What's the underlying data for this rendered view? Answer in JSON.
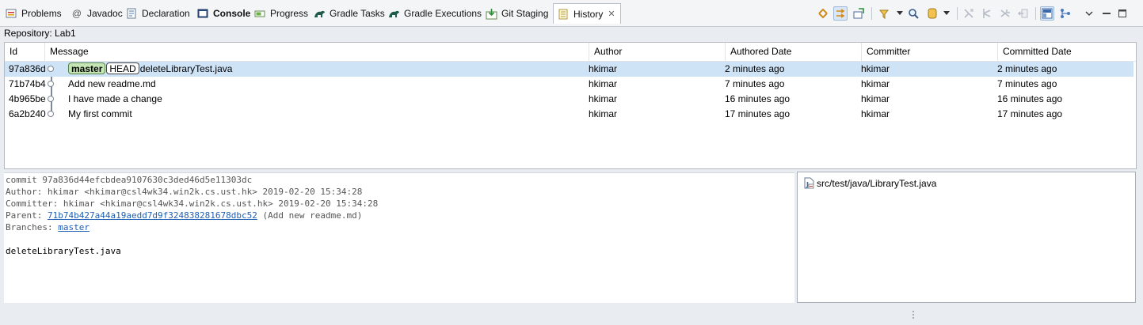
{
  "tabs": [
    {
      "label": "Problems",
      "icon": "problems-icon"
    },
    {
      "label": "Javadoc",
      "icon": "javadoc-icon"
    },
    {
      "label": "Declaration",
      "icon": "declaration-icon"
    },
    {
      "label": "Console",
      "icon": "console-icon"
    },
    {
      "label": "Progress",
      "icon": "progress-icon"
    },
    {
      "label": "Gradle Tasks",
      "icon": "gradle-icon"
    },
    {
      "label": "Gradle Executions",
      "icon": "gradle-icon"
    },
    {
      "label": "Git Staging",
      "icon": "git-staging-icon"
    },
    {
      "label": "History",
      "icon": "history-icon",
      "close": "✕"
    }
  ],
  "repository_label": "Repository: Lab1",
  "columns": [
    "Id",
    "Message",
    "Author",
    "Authored Date",
    "Committer",
    "Committed Date"
  ],
  "commits": [
    {
      "id": "97a836d",
      "refs": [
        "master",
        "HEAD"
      ],
      "message": "deleteLibraryTest.java",
      "author": "hkimar",
      "authored": "2 minutes ago",
      "committer": "hkimar",
      "committed": "2 minutes ago"
    },
    {
      "id": "71b74b4",
      "refs": [],
      "message": "Add new readme.md",
      "author": "hkimar",
      "authored": "7 minutes ago",
      "committer": "hkimar",
      "committed": "7 minutes ago"
    },
    {
      "id": "4b965be",
      "refs": [],
      "message": "I have made a change",
      "author": "hkimar",
      "authored": "16 minutes ago",
      "committer": "hkimar",
      "committed": "16 minutes ago"
    },
    {
      "id": "6a2b240",
      "refs": [],
      "message": "My first commit",
      "author": "hkimar",
      "authored": "17 minutes ago",
      "committer": "hkimar",
      "committed": "17 minutes ago"
    }
  ],
  "detail": {
    "commit_line": "commit 97a836d44efcbdea9107630c3ded46d5e11303dc",
    "author_line": "Author: hkimar <hkimar@csl4wk34.win2k.cs.ust.hk> 2019-02-20 15:34:28",
    "committer_line": "Committer: hkimar <hkimar@csl4wk34.win2k.cs.ust.hk> 2019-02-20 15:34:28",
    "parent_prefix": "Parent: ",
    "parent_hash": "71b74b427a44a19aedd7d9f324838281678dbc52",
    "parent_suffix": " (Add new readme.md)",
    "branches_prefix": "Branches: ",
    "branch": "master",
    "message": "deleteLibraryTest.java"
  },
  "changed_files": [
    "src/test/java/LibraryTest.java"
  ],
  "toolbar_icons": [
    "link-with-selection-icon",
    "show-all-branches-icon",
    "compare-mode-icon",
    "filter-icon",
    "search-icon",
    "repository-icon",
    "cherry-pick-icon",
    "rebase-icon",
    "reset-icon",
    "revert-icon",
    "layout-icon",
    "branch-graph-icon",
    "view-menu-icon",
    "minimize-icon",
    "maximize-icon"
  ],
  "colors": {
    "selection": "#cfe3f7",
    "branch_badge": "#c5e5b5",
    "link": "#1d5eb3"
  }
}
